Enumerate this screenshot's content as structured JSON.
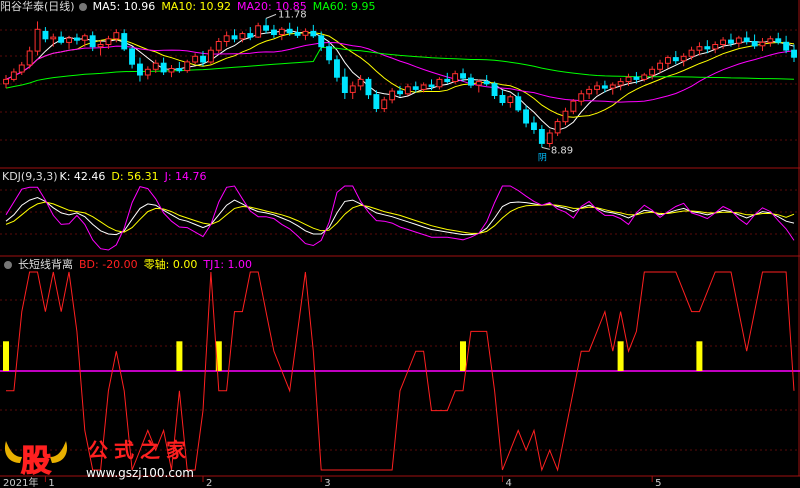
{
  "panel_main": {
    "title": "阳谷华泰(日线)",
    "ma": [
      {
        "label": "MA5: 10.96",
        "color": "#ffffff"
      },
      {
        "label": "MA10: 10.92",
        "color": "#ffff00"
      },
      {
        "label": "MA20: 10.85",
        "color": "#ff00ff"
      },
      {
        "label": "MA60: 9.95",
        "color": "#00ff00"
      }
    ],
    "high_label": "11.78",
    "low_label": "8.89",
    "low_badge": "阴"
  },
  "panel_kdj": {
    "title": "KDJ(9,3,3)",
    "k": "K: 42.46",
    "d": "D: 56.31",
    "j": "J: 14.76",
    "colors": {
      "k": "#ffffff",
      "d": "#ffff00",
      "j": "#ff00ff"
    }
  },
  "panel_ind": {
    "title": "长短线背离",
    "bd": "BD: -20.00",
    "zero": "零轴: 0.00",
    "tj1": "TJ1: 1.00",
    "colors": {
      "bd": "#ff2020",
      "zero": "#ffff00",
      "tj1": "#ff00ff"
    }
  },
  "x_axis": {
    "labels": [
      {
        "text": "2021年",
        "day": 0
      },
      {
        "text": "1",
        "day": 5
      },
      {
        "text": "2",
        "day": 25
      },
      {
        "text": "3",
        "day": 40
      },
      {
        "text": "4",
        "day": 63
      },
      {
        "text": "5",
        "day": 82
      }
    ]
  },
  "watermark": {
    "glyph": "股",
    "text": "公式之家",
    "url": "www.gszj100.com"
  },
  "chart_data": {
    "type": "candlestick",
    "title": "阳谷华泰(日线)",
    "price_range": [
      8.6,
      11.95
    ],
    "candles": [
      [
        10.35,
        10.55,
        10.25,
        10.45
      ],
      [
        10.45,
        10.7,
        10.4,
        10.62
      ],
      [
        10.62,
        10.85,
        10.55,
        10.78
      ],
      [
        10.78,
        11.2,
        10.7,
        11.1
      ],
      [
        11.1,
        11.78,
        11.0,
        11.6
      ],
      [
        11.55,
        11.65,
        11.3,
        11.38
      ],
      [
        11.38,
        11.5,
        11.2,
        11.42
      ],
      [
        11.42,
        11.55,
        11.25,
        11.3
      ],
      [
        11.3,
        11.45,
        11.15,
        11.4
      ],
      [
        11.4,
        11.5,
        11.25,
        11.35
      ],
      [
        11.35,
        11.5,
        11.2,
        11.45
      ],
      [
        11.45,
        11.55,
        11.1,
        11.2
      ],
      [
        11.2,
        11.35,
        11.0,
        11.25
      ],
      [
        11.25,
        11.45,
        11.15,
        11.38
      ],
      [
        11.38,
        11.6,
        11.3,
        11.52
      ],
      [
        11.5,
        11.6,
        11.1,
        11.15
      ],
      [
        11.15,
        11.2,
        10.7,
        10.8
      ],
      [
        10.8,
        10.95,
        10.4,
        10.55
      ],
      [
        10.55,
        10.75,
        10.45,
        10.68
      ],
      [
        10.68,
        10.9,
        10.6,
        10.82
      ],
      [
        10.82,
        10.95,
        10.55,
        10.62
      ],
      [
        10.62,
        10.78,
        10.5,
        10.7
      ],
      [
        10.7,
        10.85,
        10.6,
        10.65
      ],
      [
        10.65,
        10.9,
        10.6,
        10.85
      ],
      [
        10.85,
        11.05,
        10.8,
        10.98
      ],
      [
        10.98,
        11.1,
        10.75,
        10.85
      ],
      [
        10.85,
        11.2,
        10.8,
        11.12
      ],
      [
        11.12,
        11.4,
        11.05,
        11.32
      ],
      [
        11.32,
        11.55,
        11.2,
        11.45
      ],
      [
        11.45,
        11.6,
        11.3,
        11.38
      ],
      [
        11.38,
        11.55,
        11.3,
        11.5
      ],
      [
        11.5,
        11.65,
        11.35,
        11.42
      ],
      [
        11.42,
        11.75,
        11.4,
        11.68
      ],
      [
        11.68,
        11.85,
        11.5,
        11.58
      ],
      [
        11.58,
        11.7,
        11.4,
        11.48
      ],
      [
        11.48,
        11.65,
        11.35,
        11.6
      ],
      [
        11.6,
        11.75,
        11.45,
        11.52
      ],
      [
        11.52,
        11.66,
        11.4,
        11.46
      ],
      [
        11.46,
        11.62,
        11.35,
        11.55
      ],
      [
        11.55,
        11.7,
        11.4,
        11.45
      ],
      [
        11.45,
        11.55,
        11.1,
        11.2
      ],
      [
        11.2,
        11.3,
        10.8,
        10.9
      ],
      [
        10.9,
        11.0,
        10.4,
        10.5
      ],
      [
        10.5,
        10.7,
        10.0,
        10.15
      ],
      [
        10.15,
        10.4,
        10.0,
        10.3
      ],
      [
        10.3,
        10.55,
        10.2,
        10.45
      ],
      [
        10.45,
        10.5,
        10.0,
        10.1
      ],
      [
        10.1,
        10.2,
        9.7,
        9.78
      ],
      [
        9.78,
        10.05,
        9.7,
        9.98
      ],
      [
        9.98,
        10.25,
        9.9,
        10.18
      ],
      [
        10.18,
        10.3,
        10.05,
        10.12
      ],
      [
        10.12,
        10.35,
        10.08,
        10.28
      ],
      [
        10.28,
        10.4,
        10.15,
        10.22
      ],
      [
        10.22,
        10.38,
        10.15,
        10.32
      ],
      [
        10.32,
        10.45,
        10.2,
        10.28
      ],
      [
        10.28,
        10.5,
        10.22,
        10.45
      ],
      [
        10.45,
        10.6,
        10.35,
        10.4
      ],
      [
        10.4,
        10.65,
        10.35,
        10.58
      ],
      [
        10.58,
        10.7,
        10.4,
        10.48
      ],
      [
        10.48,
        10.58,
        10.25,
        10.32
      ],
      [
        10.32,
        10.45,
        10.15,
        10.4
      ],
      [
        10.4,
        10.55,
        10.3,
        10.35
      ],
      [
        10.35,
        10.4,
        10.0,
        10.08
      ],
      [
        10.08,
        10.2,
        9.85,
        9.92
      ],
      [
        9.92,
        10.1,
        9.8,
        10.05
      ],
      [
        10.05,
        10.15,
        9.7,
        9.75
      ],
      [
        9.75,
        9.85,
        9.35,
        9.45
      ],
      [
        9.45,
        9.6,
        9.2,
        9.3
      ],
      [
        9.3,
        9.4,
        8.89,
        8.98
      ],
      [
        8.98,
        9.3,
        8.89,
        9.22
      ],
      [
        9.22,
        9.55,
        9.15,
        9.48
      ],
      [
        9.48,
        9.8,
        9.4,
        9.72
      ],
      [
        9.72,
        10.0,
        9.65,
        9.95
      ],
      [
        9.95,
        10.2,
        9.85,
        10.12
      ],
      [
        10.12,
        10.3,
        10.0,
        10.22
      ],
      [
        10.22,
        10.4,
        10.1,
        10.3
      ],
      [
        10.3,
        10.42,
        10.15,
        10.25
      ],
      [
        10.25,
        10.38,
        10.1,
        10.32
      ],
      [
        10.32,
        10.48,
        10.2,
        10.4
      ],
      [
        10.4,
        10.58,
        10.3,
        10.5
      ],
      [
        10.5,
        10.62,
        10.35,
        10.45
      ],
      [
        10.45,
        10.6,
        10.4,
        10.55
      ],
      [
        10.55,
        10.75,
        10.45,
        10.68
      ],
      [
        10.68,
        10.9,
        10.6,
        10.82
      ],
      [
        10.82,
        11.0,
        10.7,
        10.95
      ],
      [
        10.95,
        11.1,
        10.8,
        10.88
      ],
      [
        10.88,
        11.05,
        10.75,
        10.98
      ],
      [
        10.98,
        11.2,
        10.9,
        11.12
      ],
      [
        11.12,
        11.3,
        11.0,
        11.2
      ],
      [
        11.2,
        11.35,
        11.05,
        11.15
      ],
      [
        11.15,
        11.32,
        11.05,
        11.25
      ],
      [
        11.25,
        11.42,
        11.15,
        11.35
      ],
      [
        11.35,
        11.5,
        11.2,
        11.28
      ],
      [
        11.28,
        11.45,
        11.18,
        11.4
      ],
      [
        11.4,
        11.55,
        11.25,
        11.32
      ],
      [
        11.32,
        11.48,
        11.15,
        11.22
      ],
      [
        11.22,
        11.4,
        11.1,
        11.3
      ],
      [
        11.3,
        11.45,
        11.2,
        11.38
      ],
      [
        11.38,
        11.52,
        11.25,
        11.3
      ],
      [
        11.3,
        11.45,
        11.05,
        11.12
      ],
      [
        11.12,
        11.25,
        10.85,
        10.96
      ]
    ],
    "ma_periods": [
      5,
      10,
      20,
      60
    ],
    "kdj": {
      "k": [
        45,
        55,
        70,
        78,
        82,
        76,
        66,
        58,
        55,
        58,
        52,
        40,
        30,
        25,
        24,
        30,
        48,
        65,
        72,
        70,
        62,
        55,
        48,
        45,
        40,
        35,
        40,
        55,
        70,
        78,
        72,
        65,
        60,
        58,
        55,
        50,
        45,
        38,
        30,
        25,
        25,
        35,
        58,
        76,
        78,
        72,
        65,
        58,
        55,
        52,
        48,
        44,
        40,
        36,
        32,
        30,
        28,
        26,
        24,
        24,
        26,
        34,
        50,
        68,
        74,
        75,
        74,
        72,
        70,
        72,
        68,
        65,
        60,
        66,
        70,
        65,
        60,
        58,
        55,
        50,
        56,
        62,
        60,
        55,
        58,
        62,
        65,
        60,
        58,
        55,
        58,
        62,
        60,
        55,
        50,
        55,
        60,
        58,
        52,
        45,
        42
      ],
      "d": [
        40,
        45,
        55,
        65,
        72,
        75,
        72,
        67,
        62,
        60,
        58,
        52,
        44,
        36,
        30,
        28,
        35,
        48,
        60,
        65,
        64,
        60,
        54,
        50,
        46,
        42,
        40,
        45,
        55,
        65,
        68,
        67,
        64,
        61,
        58,
        55,
        51,
        46,
        40,
        34,
        30,
        31,
        42,
        56,
        66,
        70,
        68,
        64,
        60,
        57,
        54,
        50,
        46,
        42,
        38,
        35,
        32,
        30,
        28,
        26,
        26,
        29,
        38,
        50,
        60,
        66,
        69,
        70,
        70,
        71,
        70,
        68,
        65,
        65,
        67,
        66,
        63,
        60,
        58,
        55,
        55,
        58,
        59,
        57,
        57,
        59,
        61,
        61,
        60,
        58,
        58,
        59,
        59,
        58,
        55,
        55,
        57,
        57,
        55,
        51,
        56
      ],
      "j": [
        55,
        75,
        95,
        98,
        98,
        78,
        54,
        40,
        41,
        54,
        40,
        16,
        2,
        0,
        8,
        34,
        74,
        99,
        96,
        80,
        58,
        45,
        36,
        35,
        28,
        21,
        40,
        75,
        98,
        100,
        80,
        61,
        52,
        52,
        49,
        40,
        33,
        22,
        10,
        7,
        15,
        43,
        90,
        100,
        100,
        76,
        59,
        46,
        45,
        42,
        36,
        32,
        28,
        24,
        20,
        20,
        20,
        18,
        16,
        20,
        26,
        44,
        74,
        100,
        100,
        93,
        84,
        76,
        70,
        74,
        64,
        59,
        50,
        68,
        76,
        63,
        54,
        54,
        49,
        40,
        58,
        70,
        62,
        51,
        60,
        68,
        73,
        58,
        54,
        49,
        58,
        68,
        62,
        49,
        40,
        55,
        66,
        60,
        46,
        33,
        15
      ]
    },
    "indicator": {
      "bd_range": [
        -100,
        100
      ],
      "bd": [
        -20,
        -20,
        60,
        100,
        100,
        60,
        100,
        60,
        100,
        40,
        -60,
        -100,
        -100,
        -20,
        20,
        -20,
        -100,
        -80,
        -60,
        -80,
        -60,
        -100,
        -20,
        -100,
        -100,
        -40,
        100,
        -20,
        -20,
        60,
        60,
        100,
        100,
        60,
        20,
        0,
        -20,
        40,
        100,
        20,
        -100,
        -100,
        -100,
        -100,
        -100,
        -100,
        -100,
        -100,
        -100,
        -100,
        -20,
        0,
        20,
        20,
        -40,
        -40,
        -40,
        -20,
        -20,
        40,
        40,
        40,
        -20,
        -100,
        -80,
        -60,
        -80,
        -60,
        -100,
        -80,
        -100,
        -60,
        -20,
        20,
        20,
        40,
        60,
        20,
        60,
        20,
        40,
        100,
        100,
        100,
        100,
        100,
        80,
        60,
        60,
        80,
        100,
        100,
        100,
        60,
        20,
        60,
        100,
        100,
        100,
        100,
        -20
      ],
      "signals": [
        0,
        22,
        27,
        58,
        78,
        88
      ],
      "tj1": [
        -100,
        0
      ]
    }
  }
}
